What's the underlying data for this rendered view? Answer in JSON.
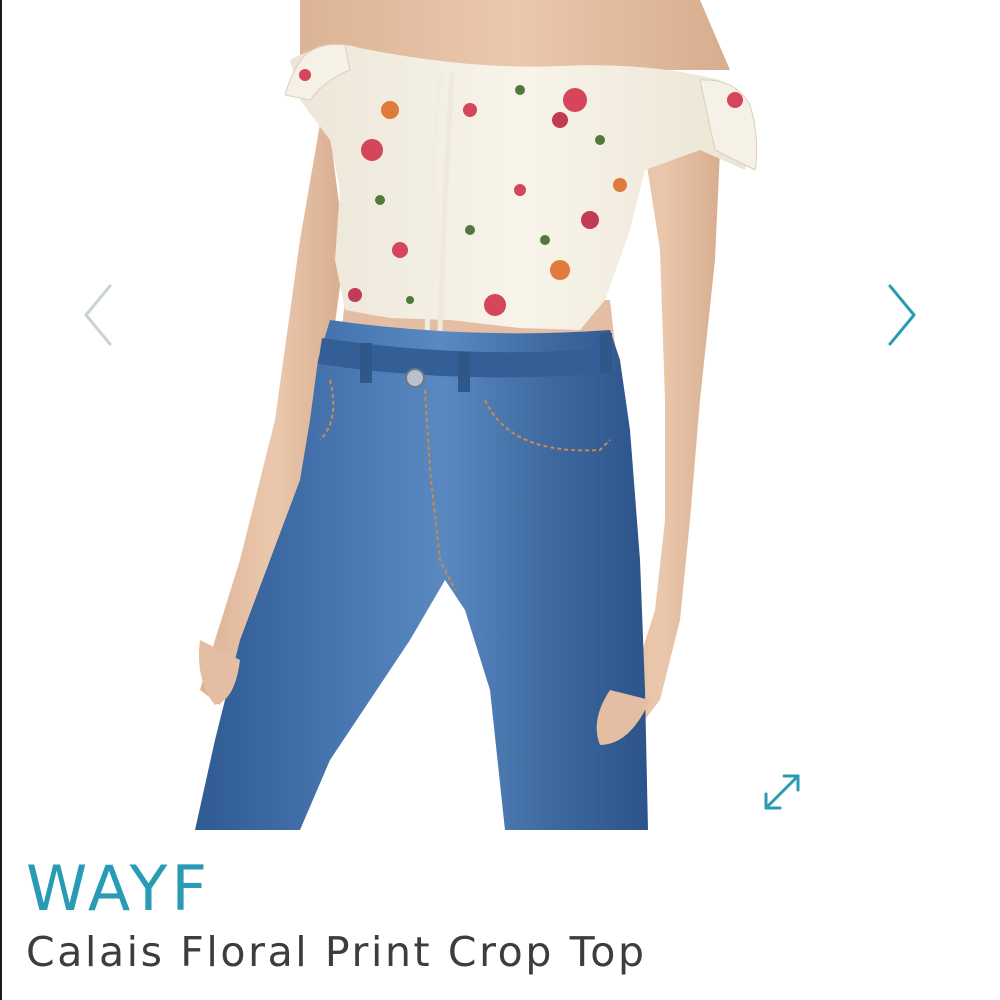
{
  "product": {
    "brand": "WAYF",
    "title": "Calais Floral Print Crop Top",
    "image_alt": "Model wearing floral off-the-shoulder crop top with high-waisted blue jeans"
  },
  "gallery": {
    "prev_icon": "chevron-left-icon",
    "next_icon": "chevron-right-icon",
    "expand_icon": "expand-arrows-icon"
  },
  "colors": {
    "accent": "#2a9bb5",
    "prev_arrow": "#c9d3d6",
    "title_text": "#3d3d3d",
    "denim": "#3f6aa3",
    "top_fabric": "#f4efe3",
    "skin": "#e6c1a5"
  }
}
